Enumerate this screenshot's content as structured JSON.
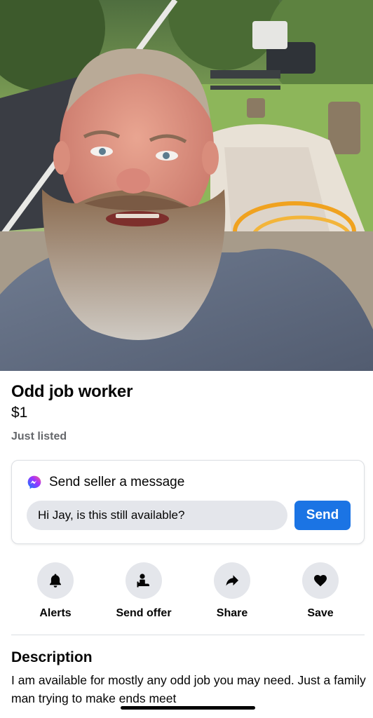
{
  "listing": {
    "title": "Odd job worker",
    "price": "$1",
    "status": "Just listed",
    "photo_description": "listing-photo"
  },
  "message_card": {
    "icon": "messenger-icon",
    "heading": "Send seller a message",
    "input_value": "Hi Jay, is this still available?",
    "send_label": "Send"
  },
  "actions": [
    {
      "label": "Alerts",
      "icon": "bell-icon"
    },
    {
      "label": "Send offer",
      "icon": "offer-icon"
    },
    {
      "label": "Share",
      "icon": "share-icon"
    },
    {
      "label": "Save",
      "icon": "heart-icon"
    }
  ],
  "description": {
    "heading": "Description",
    "text": "I am available for mostly any odd job you may need. Just a family man trying to make ends meet"
  },
  "colors": {
    "accent": "#1b74e4",
    "secondary_text": "#65676b",
    "chip_bg": "#e4e6eb"
  }
}
